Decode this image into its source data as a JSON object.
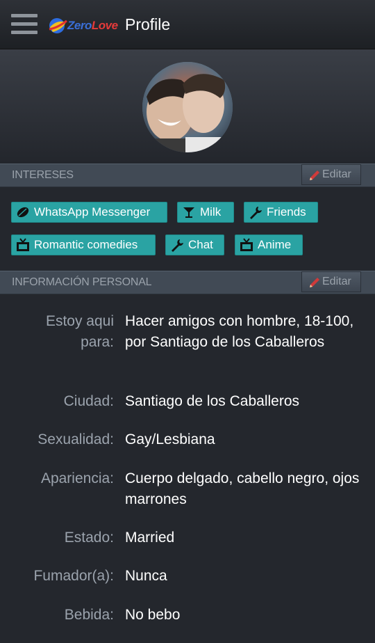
{
  "header": {
    "menu_icon": "hamburger-menu-icon",
    "logo_zero": "Zero",
    "logo_love": "Love",
    "title": "Profile"
  },
  "colors": {
    "accent": "#2aa3a3",
    "background": "#24272d",
    "section": "#414a55"
  },
  "interests": {
    "heading": "INTERESES",
    "edit_label": "Editar",
    "chips": [
      {
        "label": "WhatsApp Messenger",
        "icon": "leaf-icon"
      },
      {
        "label": "Milk",
        "icon": "cocktail-icon"
      },
      {
        "label": "Friends",
        "icon": "wrench-icon"
      },
      {
        "label": "Romantic comedies",
        "icon": "tv-icon"
      },
      {
        "label": "Chat",
        "icon": "wrench-icon"
      },
      {
        "label": "Anime",
        "icon": "tv-icon"
      }
    ]
  },
  "personal": {
    "heading": "INFORMACIÓN PERSONAL",
    "edit_label": "Editar",
    "rows": [
      {
        "key": "Estoy aqui para:",
        "value": "Hacer amigos con hombre, 18-100, por Santiago de los Caballeros"
      },
      {
        "key": "Ciudad:",
        "value": "Santiago de los Caballeros"
      },
      {
        "key": "Sexualidad:",
        "value": "Gay/Lesbiana"
      },
      {
        "key": "Apariencia:",
        "value": "Cuerpo delgado, cabello negro, ojos marrones"
      },
      {
        "key": "Estado:",
        "value": "Married"
      },
      {
        "key": "Fumador(a):",
        "value": "Nunca"
      },
      {
        "key": "Bebida:",
        "value": "No bebo"
      }
    ]
  }
}
